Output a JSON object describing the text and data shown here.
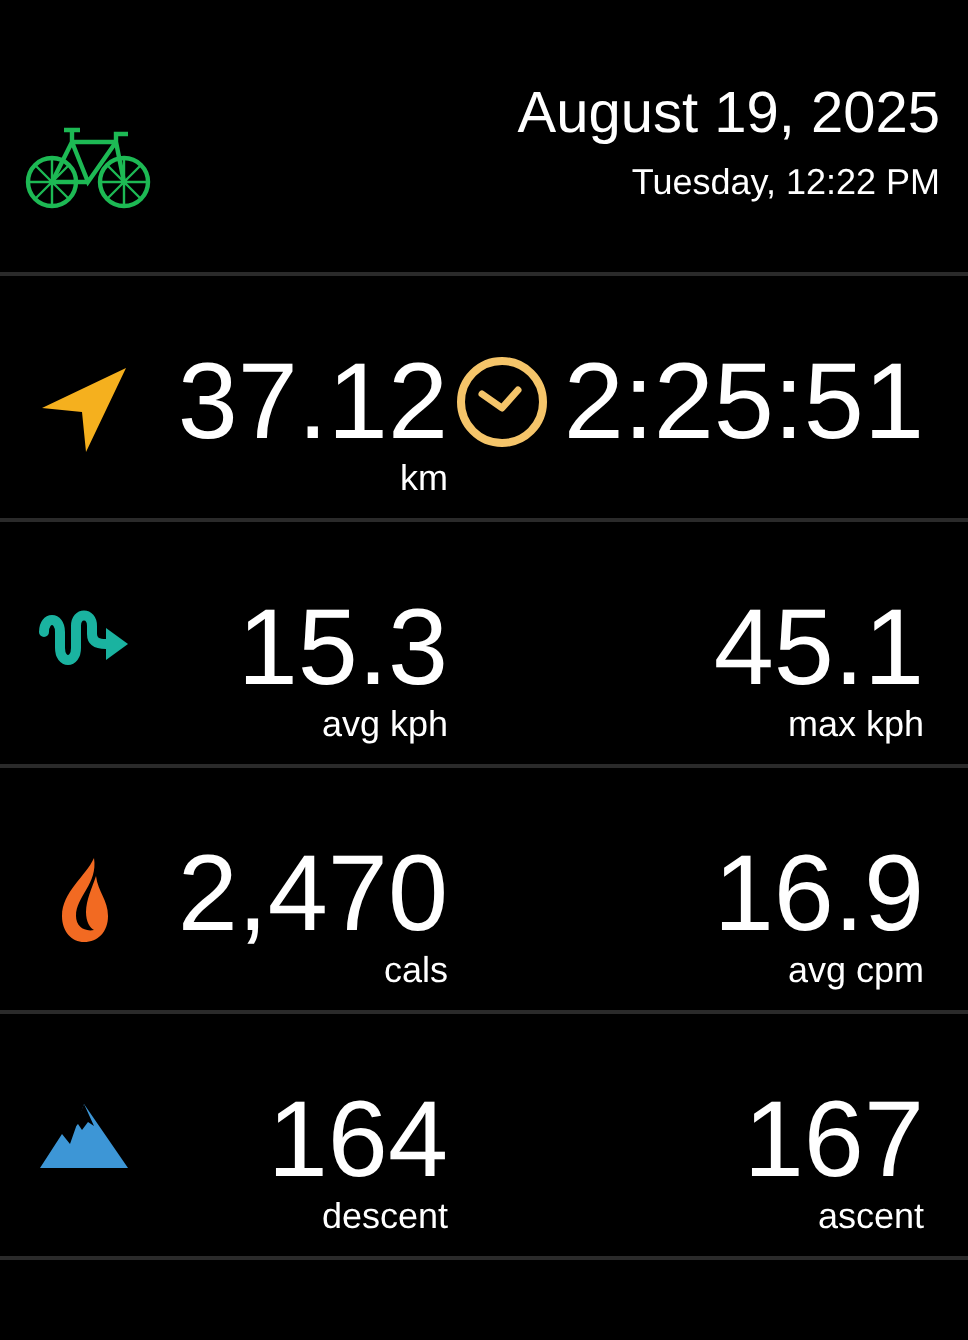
{
  "header": {
    "date": "August 19, 2025",
    "day_time": "Tuesday, 12:22 PM"
  },
  "rows": [
    {
      "kind": "distance",
      "left": {
        "value": "37.12",
        "unit": "km"
      },
      "right": {
        "kind": "duration",
        "value": "2:25:51"
      }
    },
    {
      "kind": "speed",
      "left": {
        "value": "15.3",
        "unit": "avg kph"
      },
      "right": {
        "kind": "plain",
        "value": "45.1",
        "unit": "max kph"
      }
    },
    {
      "kind": "calories",
      "left": {
        "value": "2,470",
        "unit": "cals"
      },
      "right": {
        "kind": "plain",
        "value": "16.9",
        "unit": "avg cpm"
      }
    },
    {
      "kind": "elevation",
      "left": {
        "value": "164",
        "unit": "descent"
      },
      "right": {
        "kind": "plain",
        "value": "167",
        "unit": "ascent"
      }
    }
  ]
}
